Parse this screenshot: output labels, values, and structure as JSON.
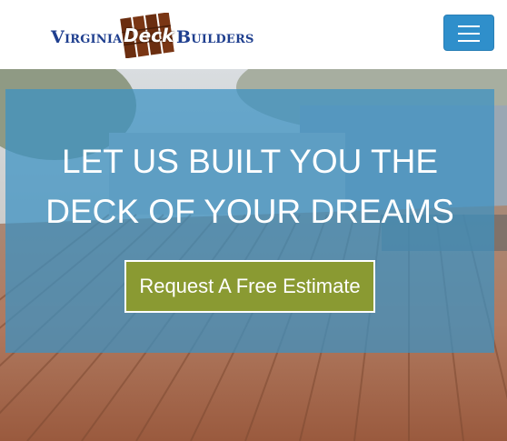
{
  "header": {
    "logo": {
      "word1": "Virginia",
      "word2": "Deck",
      "word3": "Builders"
    },
    "menu_icon": "hamburger-icon"
  },
  "hero": {
    "headline_line1": "LET US BUILT YOU THE",
    "headline_line2": "DECK OF YOUR DREAMS",
    "cta_label": "Request A Free Estimate"
  },
  "colors": {
    "menu_button": "#2f8fcb",
    "overlay": "#3a92c4",
    "cta_button": "#8a9a32",
    "logo_text": "#1f3f8f",
    "logo_boards": "#6b2e10"
  }
}
